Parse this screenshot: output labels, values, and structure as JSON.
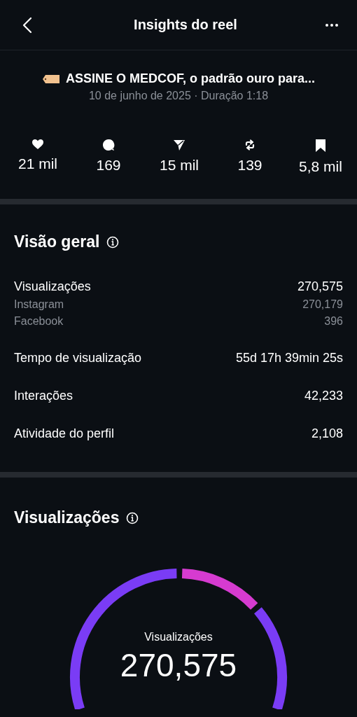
{
  "header": {
    "title": "Insights do reel"
  },
  "reel": {
    "caption": "ASSINE O MEDCOF, o padrão ouro para...",
    "meta": "10 de junho de 2025 · Duração 1:18"
  },
  "stats": [
    {
      "kind": "likes",
      "value": "21 mil"
    },
    {
      "kind": "comments",
      "value": "169"
    },
    {
      "kind": "shares",
      "value": "15 mil"
    },
    {
      "kind": "reposts",
      "value": "139"
    },
    {
      "kind": "saves",
      "value": "5,8 mil"
    }
  ],
  "overview": {
    "title": "Visão geral",
    "rows": [
      {
        "label": "Visualizações",
        "value": "270,575",
        "breakdown": [
          {
            "label": "Instagram",
            "value": "270,179"
          },
          {
            "label": "Facebook",
            "value": "396"
          }
        ]
      },
      {
        "label": "Tempo de visualização",
        "value": "55d 17h 39min 25s"
      },
      {
        "label": "Interações",
        "value": "42,233"
      },
      {
        "label": "Atividade do perfil",
        "value": "2,108"
      }
    ]
  },
  "views": {
    "title": "Visualizações",
    "gauge_label": "Visualizações",
    "gauge_value": "270,575"
  }
}
